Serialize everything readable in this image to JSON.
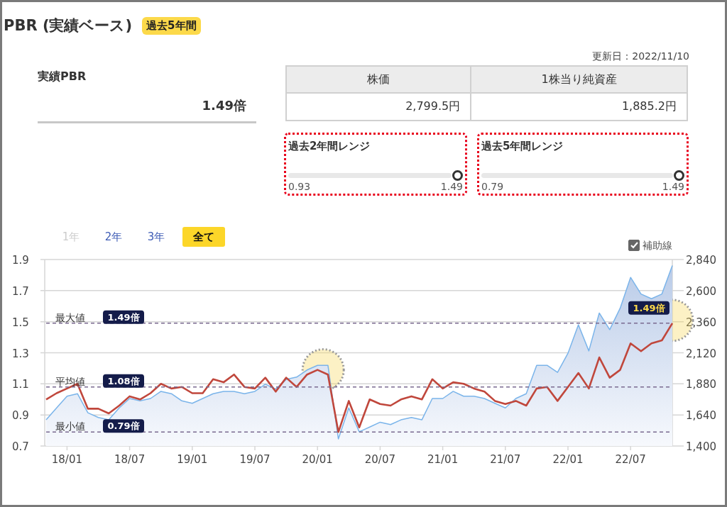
{
  "title": "PBR (実績ベース)",
  "period_badge": "過去5年間",
  "updated": "更新日：2022/11/10",
  "actual_pbr": {
    "label": "実績PBR",
    "value": "1.49倍"
  },
  "stats_table": {
    "columns": [
      "株価",
      "1株当り純資産"
    ],
    "values": [
      "2,799.5円",
      "1,885.2円"
    ]
  },
  "ranges": [
    {
      "title": "過去2年間レンジ",
      "level": 1,
      "min": "0.93",
      "max": "1.49"
    },
    {
      "title": "過去5年間レンジ",
      "level": 1,
      "min": "0.79",
      "max": "1.49"
    }
  ],
  "range_buttons": [
    {
      "label": "1年",
      "selected": false,
      "disabled": true
    },
    {
      "label": "2年",
      "selected": false,
      "disabled": false
    },
    {
      "label": "3年",
      "selected": false,
      "disabled": false
    },
    {
      "label": "全て",
      "selected": true,
      "disabled": false
    }
  ],
  "guide_lines": {
    "label": "補助線",
    "checked": true
  },
  "chart": {
    "chart_data": {
      "type": "line",
      "categories": [
        null,
        null,
        "18/01",
        null,
        null,
        null,
        null,
        null,
        "18/07",
        null,
        null,
        null,
        null,
        null,
        "19/01",
        null,
        null,
        null,
        null,
        null,
        "19/07",
        null,
        null,
        null,
        null,
        null,
        "20/01",
        null,
        null,
        null,
        null,
        null,
        "20/07",
        null,
        null,
        null,
        null,
        null,
        "21/01",
        null,
        null,
        null,
        null,
        null,
        "21/07",
        null,
        null,
        null,
        null,
        null,
        "22/01",
        null,
        null,
        null,
        null,
        null,
        "22/07",
        null,
        null,
        null,
        null
      ],
      "ylim": [
        0.7,
        1.9
      ],
      "yticks": [
        0.7,
        0.9,
        1.1,
        1.3,
        1.5,
        1.7,
        1.9
      ],
      "y2lim": [
        1400,
        2840
      ],
      "y2ticks": [
        {
          "value": 1400,
          "label": "1,400"
        },
        {
          "value": 1640,
          "label": "1,640"
        },
        {
          "value": 1880,
          "label": "1,880"
        },
        {
          "value": 2120,
          "label": "2,120"
        },
        {
          "value": 2360,
          "label": "2,360"
        },
        {
          "value": 2600,
          "label": "2,600"
        },
        {
          "value": 2840,
          "label": "2,840"
        }
      ],
      "series": [
        {
          "type": "area",
          "axis": "y2",
          "color": "#7ab4ea",
          "values": [
            1602,
            1694,
            1785,
            1804,
            1657,
            1620,
            1602,
            1694,
            1767,
            1749,
            1767,
            1822,
            1804,
            1749,
            1730,
            1767,
            1804,
            1822,
            1822,
            1804,
            1822,
            1877,
            1840,
            1914,
            1932,
            1987,
            2023,
            2023,
            1455,
            1694,
            1510,
            1547,
            1584,
            1566,
            1602,
            1620,
            1602,
            1767,
            1767,
            1822,
            1785,
            1785,
            1767,
            1730,
            1694,
            1767,
            1804,
            2023,
            2023,
            1969,
            2116,
            2336,
            2134,
            2427,
            2299,
            2464,
            2702,
            2574,
            2537,
            2574,
            2794
          ]
        },
        {
          "color": "#c0473c",
          "values": [
            1.0,
            1.04,
            1.07,
            1.1,
            0.94,
            0.94,
            0.91,
            0.96,
            1.02,
            1.0,
            1.04,
            1.1,
            1.07,
            1.08,
            1.04,
            1.04,
            1.13,
            1.11,
            1.16,
            1.08,
            1.07,
            1.14,
            1.05,
            1.14,
            1.08,
            1.16,
            1.19,
            1.16,
            0.79,
            0.99,
            0.82,
            1.0,
            0.97,
            0.96,
            1.0,
            1.02,
            1.0,
            1.13,
            1.07,
            1.11,
            1.1,
            1.07,
            1.05,
            0.99,
            0.97,
            0.99,
            0.96,
            1.07,
            1.08,
            0.99,
            1.08,
            1.17,
            1.07,
            1.27,
            1.14,
            1.19,
            1.36,
            1.31,
            1.36,
            1.38,
            1.49
          ]
        }
      ],
      "ref_lines": [
        {
          "axis": "y",
          "value": 1.49,
          "label": "1.49倍"
        },
        {
          "axis": "y",
          "value": 1.08,
          "label": "1.08倍"
        },
        {
          "axis": "y",
          "value": 0.79,
          "label": "0.79倍"
        }
      ],
      "annotations": [
        "1.49倍"
      ],
      "grid": true
    },
    "reference_names": [
      "最大値",
      "平均値",
      "最小値"
    ]
  }
}
